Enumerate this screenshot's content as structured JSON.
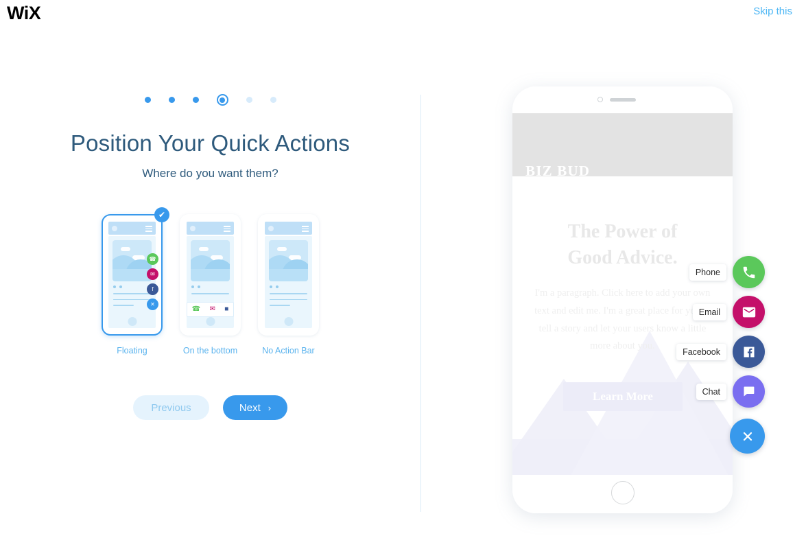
{
  "header": {
    "logo_text": "WiX",
    "skip_label": "Skip this"
  },
  "progress": {
    "total_steps": 6,
    "current_step": 4,
    "steps": [
      {
        "state": "done"
      },
      {
        "state": "done"
      },
      {
        "state": "done"
      },
      {
        "state": "active"
      },
      {
        "state": "upcoming"
      },
      {
        "state": "upcoming"
      }
    ]
  },
  "wizard": {
    "title": "Position Your Quick Actions",
    "subtitle": "Where do you want them?",
    "options": [
      {
        "id": "floating",
        "label": "Floating",
        "selected": true,
        "check_glyph": "✔"
      },
      {
        "id": "on-the-bottom",
        "label": "On the bottom",
        "selected": false
      },
      {
        "id": "no-action-bar",
        "label": "No Action Bar",
        "selected": false
      }
    ],
    "previous_label": "Previous",
    "next_label": "Next",
    "next_chevron": "›"
  },
  "preview": {
    "site_name": "BIZ BUD",
    "heading_line1": "The Power of",
    "heading_line2": "Good Advice.",
    "paragraph": "I'm a paragraph. Click here to add your own text and edit me. I'm a great place for you to tell a story and let your users know a little more about you.",
    "cta_label": "Learn More",
    "quick_actions": [
      {
        "id": "phone",
        "tooltip": "Phone",
        "icon": "phone-icon",
        "color": "#5bc85b"
      },
      {
        "id": "email",
        "tooltip": "Email",
        "icon": "email-icon",
        "color": "#c4106a"
      },
      {
        "id": "facebook",
        "tooltip": "Facebook",
        "icon": "facebook-icon",
        "color": "#3b5998"
      },
      {
        "id": "chat",
        "tooltip": "Chat",
        "icon": "chat-icon",
        "color": "#7a6ef0"
      },
      {
        "id": "close",
        "tooltip": "",
        "icon": "close-icon",
        "color": "#3899ec"
      }
    ]
  },
  "colors": {
    "accent": "#3899ec",
    "title": "#2e5a7c",
    "label": "#5ab3ee",
    "divider": "#d9ecf8"
  }
}
